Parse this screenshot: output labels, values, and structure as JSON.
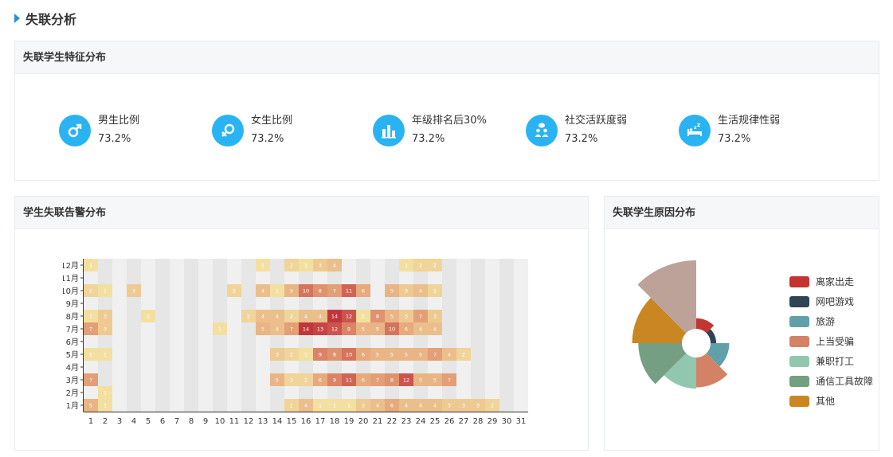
{
  "page": {
    "title": "失联分析"
  },
  "features": {
    "title": "失联学生特征分布",
    "items": [
      {
        "icon": "male-icon",
        "label": "男生比例",
        "value": "73.2%"
      },
      {
        "icon": "female-icon",
        "label": "女生比例",
        "value": "73.2%"
      },
      {
        "icon": "bar-chart-icon",
        "label": "年级排名后30%",
        "value": "73.2%"
      },
      {
        "icon": "social-icon",
        "label": "社交活跃度弱",
        "value": "73.2%"
      },
      {
        "icon": "sleep-icon",
        "label": "生活规律性弱",
        "value": "73.2%"
      }
    ]
  },
  "heatmap": {
    "title": "学生失联告警分布"
  },
  "reasons": {
    "title": "失联学生原因分布"
  },
  "chart_data": [
    {
      "type": "heatmap",
      "title": "",
      "x": [
        1,
        2,
        3,
        4,
        5,
        6,
        7,
        8,
        9,
        10,
        11,
        12,
        13,
        14,
        15,
        16,
        17,
        18,
        19,
        20,
        21,
        22,
        23,
        24,
        25,
        26,
        27,
        28,
        29,
        30,
        31
      ],
      "y": [
        "1月",
        "2月",
        "3月",
        "4月",
        "5月",
        "6月",
        "7月",
        "8月",
        "9月",
        "10月",
        "11月",
        "12月"
      ],
      "colors": {
        "low": "#f3dfa0",
        "mid": "#e29a72",
        "high": "#c1363c",
        "empty_a": "#f0f0f0",
        "empty_b": "#e6e6e6"
      },
      "values": [
        [
          5,
          1,
          0,
          0,
          0,
          0,
          0,
          0,
          0,
          0,
          0,
          0,
          0,
          0,
          2,
          4,
          1,
          1,
          1,
          3,
          4,
          6,
          4,
          4,
          4,
          3,
          3,
          3,
          2,
          0,
          0
        ],
        [
          0,
          1,
          0,
          0,
          0,
          0,
          0,
          0,
          0,
          0,
          0,
          0,
          0,
          0,
          0,
          0,
          0,
          0,
          0,
          0,
          0,
          0,
          0,
          0,
          0,
          0,
          0,
          0,
          0,
          0,
          0
        ],
        [
          7,
          0,
          0,
          0,
          0,
          0,
          0,
          0,
          0,
          0,
          0,
          0,
          0,
          5,
          2,
          2,
          6,
          9,
          11,
          6,
          7,
          8,
          12,
          5,
          5,
          7,
          0,
          0,
          0,
          0,
          0
        ],
        [
          0,
          0,
          0,
          0,
          0,
          0,
          0,
          0,
          0,
          0,
          0,
          0,
          0,
          0,
          0,
          0,
          0,
          0,
          0,
          0,
          0,
          0,
          0,
          0,
          0,
          0,
          0,
          0,
          0,
          0,
          0
        ],
        [
          1,
          1,
          0,
          0,
          0,
          0,
          0,
          0,
          0,
          0,
          0,
          0,
          0,
          3,
          2,
          1,
          9,
          8,
          10,
          6,
          5,
          5,
          5,
          5,
          7,
          4,
          2,
          0,
          0,
          0,
          0
        ],
        [
          0,
          0,
          0,
          0,
          0,
          0,
          0,
          0,
          0,
          0,
          0,
          0,
          0,
          0,
          0,
          0,
          0,
          0,
          0,
          0,
          0,
          0,
          0,
          0,
          0,
          0,
          0,
          0,
          0,
          0,
          0
        ],
        [
          7,
          3,
          0,
          0,
          0,
          0,
          0,
          0,
          0,
          1,
          0,
          0,
          5,
          4,
          7,
          14,
          13,
          12,
          9,
          5,
          5,
          10,
          6,
          4,
          4,
          0,
          0,
          0,
          0,
          0,
          0
        ],
        [
          1,
          3,
          0,
          0,
          1,
          0,
          0,
          0,
          0,
          0,
          0,
          2,
          4,
          4,
          2,
          4,
          4,
          14,
          12,
          1,
          8,
          5,
          3,
          7,
          3,
          0,
          0,
          0,
          0,
          0,
          0
        ],
        [
          0,
          0,
          0,
          0,
          0,
          0,
          0,
          0,
          0,
          0,
          0,
          0,
          0,
          0,
          0,
          0,
          0,
          0,
          0,
          0,
          0,
          0,
          0,
          0,
          0,
          0,
          0,
          0,
          0,
          0,
          0
        ],
        [
          2,
          1,
          0,
          3,
          0,
          0,
          0,
          0,
          0,
          0,
          2,
          0,
          4,
          1,
          5,
          10,
          8,
          7,
          11,
          6,
          0,
          5,
          3,
          4,
          2,
          0,
          0,
          0,
          0,
          0,
          0
        ],
        [
          0,
          0,
          0,
          0,
          0,
          0,
          0,
          0,
          0,
          0,
          0,
          0,
          0,
          0,
          0,
          0,
          0,
          0,
          0,
          0,
          0,
          0,
          0,
          0,
          0,
          0,
          0,
          0,
          0,
          0,
          0
        ],
        [
          1,
          0,
          0,
          0,
          0,
          0,
          0,
          0,
          0,
          0,
          0,
          0,
          1,
          0,
          2,
          1,
          3,
          4,
          0,
          0,
          0,
          0,
          1,
          2,
          2,
          0,
          0,
          0,
          0,
          0,
          0
        ]
      ],
      "grid": false
    },
    {
      "type": "pie",
      "subtype": "rose",
      "title": "",
      "categories": [
        "离家出走",
        "网吧游戏",
        "旅游",
        "上当受骗",
        "兼职打工",
        "通信工具故障",
        "其他"
      ],
      "colors": [
        "#c23531",
        "#2f4554",
        "#61a0a8",
        "#d48265",
        "#91c7ae",
        "#749f83",
        "#ca8622"
      ],
      "extra_slice": {
        "color": "#bda29a"
      },
      "values": [
        17,
        9,
        30,
        48,
        50,
        70,
        80
      ],
      "extra_value": 110,
      "legend": "right"
    }
  ]
}
